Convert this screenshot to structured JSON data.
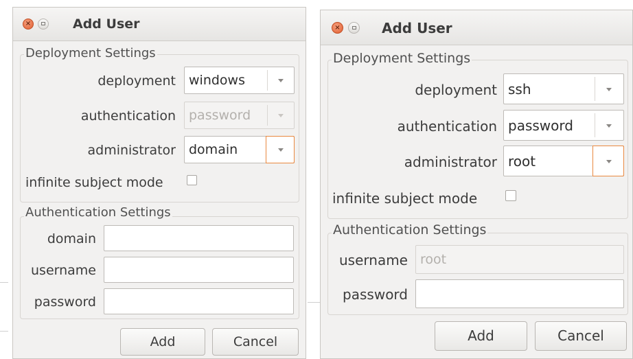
{
  "dialogs": [
    {
      "title": "Add User",
      "deployment_settings": {
        "legend": "Deployment Settings",
        "deployment_label": "deployment",
        "deployment_value": "windows",
        "authentication_label": "authentication",
        "authentication_value": "password",
        "authentication_disabled": true,
        "administrator_label": "administrator",
        "administrator_value": "domain",
        "infinite_label": "infinite subject mode",
        "infinite_checked": false
      },
      "authentication_settings": {
        "legend": "Authentication Settings",
        "fields": [
          {
            "label": "domain",
            "value": ""
          },
          {
            "label": "username",
            "value": ""
          },
          {
            "label": "password",
            "value": ""
          }
        ]
      },
      "buttons": {
        "add": "Add",
        "cancel": "Cancel"
      }
    },
    {
      "title": "Add User",
      "deployment_settings": {
        "legend": "Deployment Settings",
        "deployment_label": "deployment",
        "deployment_value": "ssh",
        "authentication_label": "authentication",
        "authentication_value": "password",
        "authentication_disabled": false,
        "administrator_label": "administrator",
        "administrator_value": "root",
        "infinite_label": "infinite subject mode",
        "infinite_checked": false
      },
      "authentication_settings": {
        "legend": "Authentication Settings",
        "fields": [
          {
            "label": "username",
            "placeholder": "root",
            "disabled": true
          },
          {
            "label": "password",
            "value": ""
          }
        ]
      },
      "buttons": {
        "add": "Add",
        "cancel": "Cancel"
      }
    }
  ],
  "colors": {
    "window_bg": "#f2f1f0",
    "close_button": "#e05d30",
    "focus_ring": "#e9883f"
  }
}
